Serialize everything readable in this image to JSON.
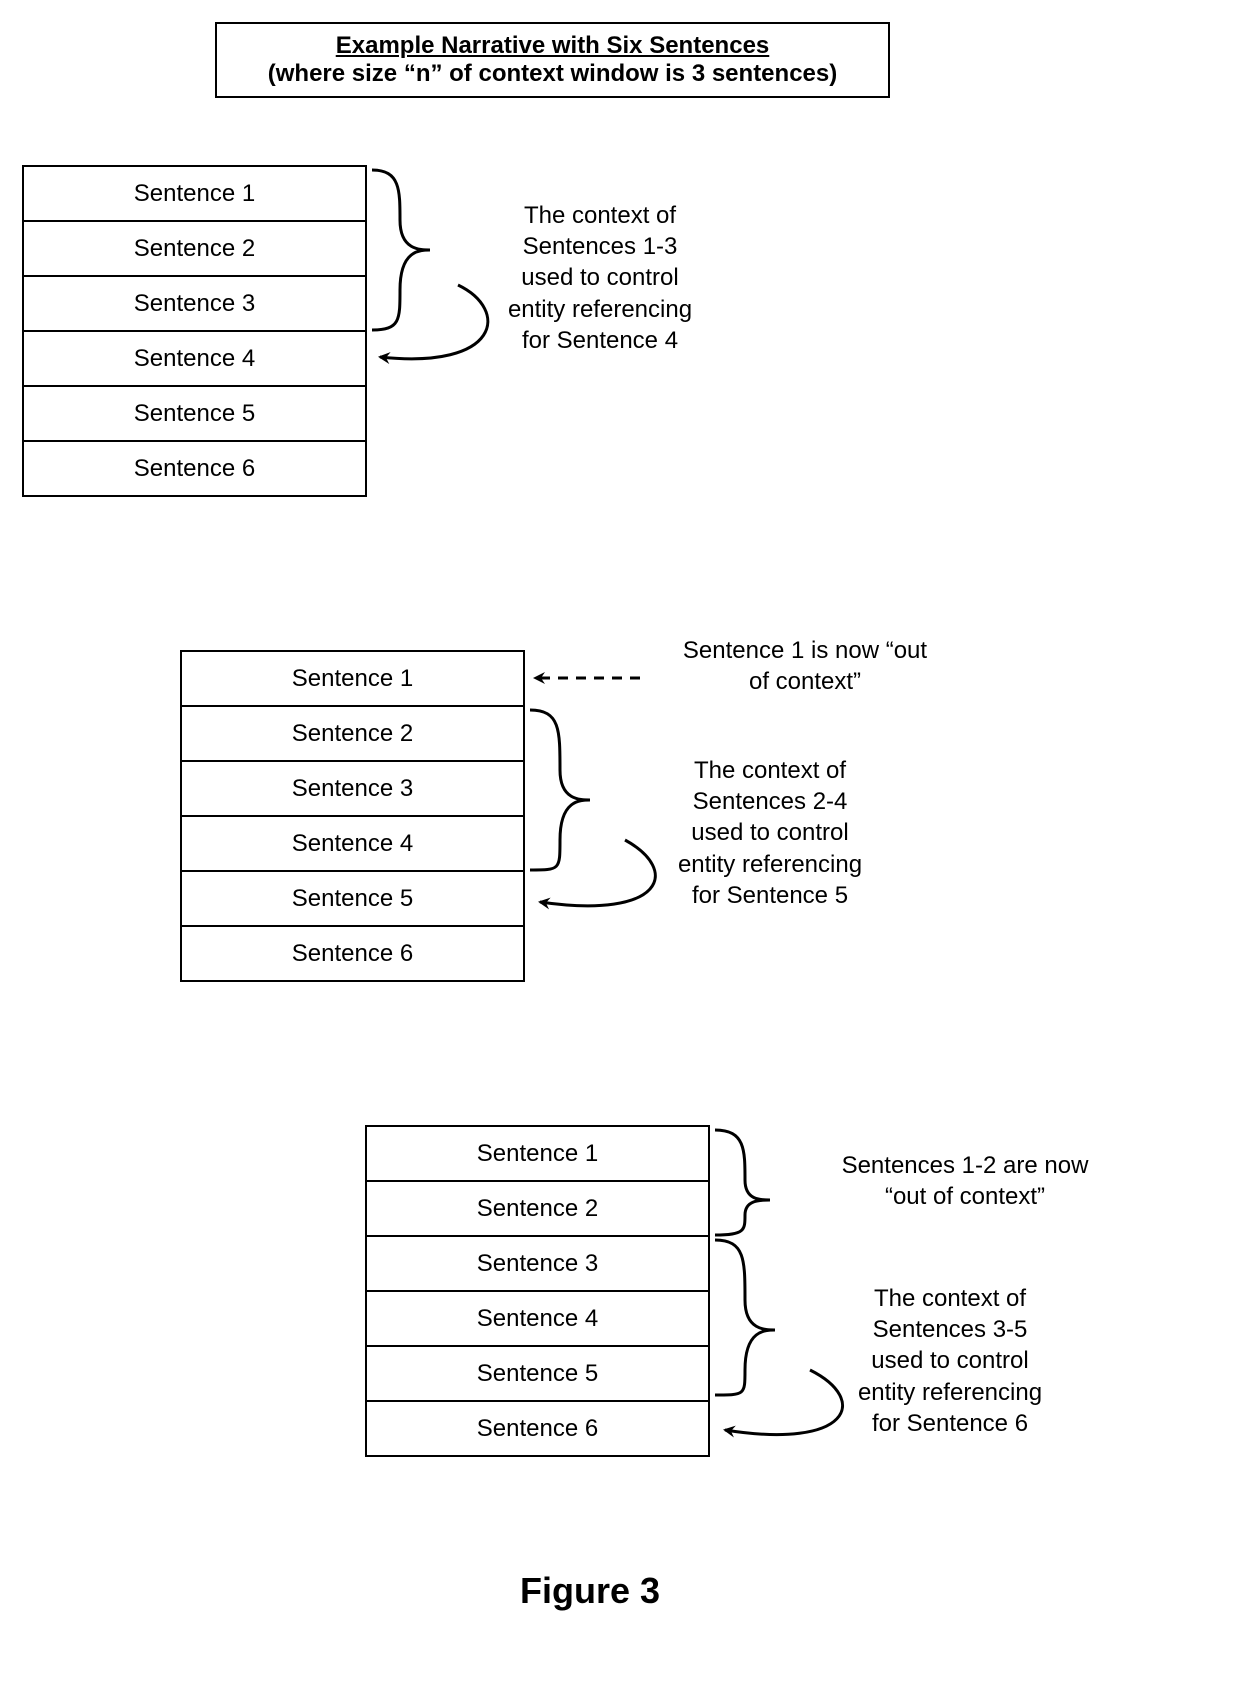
{
  "title": {
    "line1": "Example Narrative with Six Sentences",
    "line2": "(where size “n” of context window is 3 sentences)"
  },
  "panels": [
    {
      "sentences": [
        "Sentence 1",
        "Sentence 2",
        "Sentence 3",
        "Sentence 4",
        "Sentence 5",
        "Sentence 6"
      ],
      "context_note": "The context of\nSentences 1-3\nused to control\nentity referencing\nfor Sentence 4",
      "out_note": null
    },
    {
      "sentences": [
        "Sentence 1",
        "Sentence 2",
        "Sentence 3",
        "Sentence 4",
        "Sentence 5",
        "Sentence 6"
      ],
      "context_note": "The context of\nSentences 2-4\nused to control\nentity referencing\nfor Sentence 5",
      "out_note": "Sentence 1 is now “out\nof context”"
    },
    {
      "sentences": [
        "Sentence 1",
        "Sentence 2",
        "Sentence 3",
        "Sentence 4",
        "Sentence 5",
        "Sentence 6"
      ],
      "context_note": "The context of\nSentences 3-5\nused to control\nentity referencing\nfor Sentence 6",
      "out_note": "Sentences 1-2 are now\n“out of context”"
    }
  ],
  "figure_label": "Figure 3"
}
